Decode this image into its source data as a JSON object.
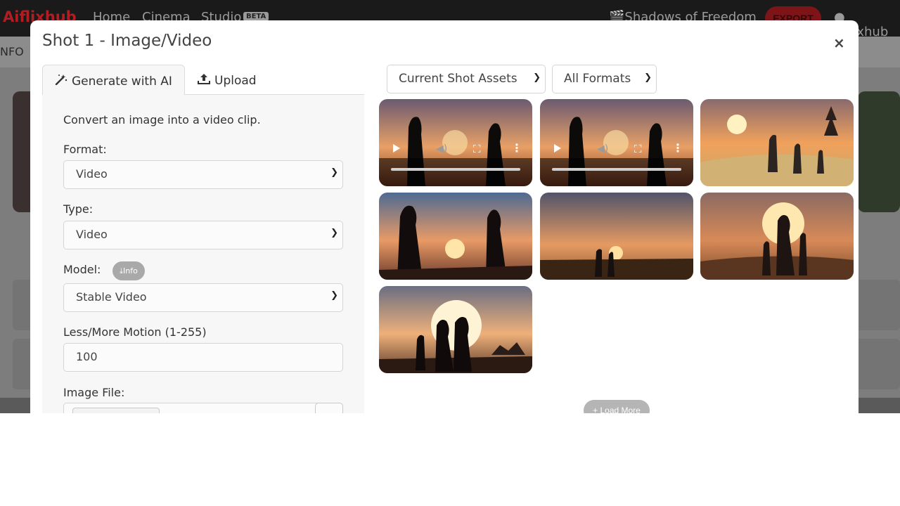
{
  "nav": {
    "brand": "Aiflixhub",
    "links": [
      "Home",
      "Cinema",
      "Studio"
    ],
    "beta": "BETA",
    "project": "Shadows of Freedom",
    "export": "EXPORT",
    "user": "aiflixhub"
  },
  "subbar": {
    "label": "NFO"
  },
  "modal": {
    "title": "Shot 1 - Image/Video",
    "close": "×",
    "tabs": [
      {
        "label": "Generate with AI",
        "icon": "magic-wand-icon"
      },
      {
        "label": "Upload",
        "icon": "upload-icon"
      }
    ],
    "form": {
      "description": "Convert an image into a video clip.",
      "format_label": "Format:",
      "format_value": "Video",
      "type_label": "Type:",
      "type_value": "Video",
      "model_label": "Model:",
      "model_info": "Info",
      "model_value": "Stable Video",
      "motion_label": "Less/More Motion (1-255)",
      "motion_value": "100",
      "image_label": "Image File:"
    },
    "assets": {
      "scope": "Current Shot Assets",
      "formats": "All Formats",
      "load_more": "Load More"
    }
  },
  "colors": {
    "accent": "#b01d22",
    "panel_bg": "#f7f7f7",
    "pill": "#a9a9a9"
  }
}
